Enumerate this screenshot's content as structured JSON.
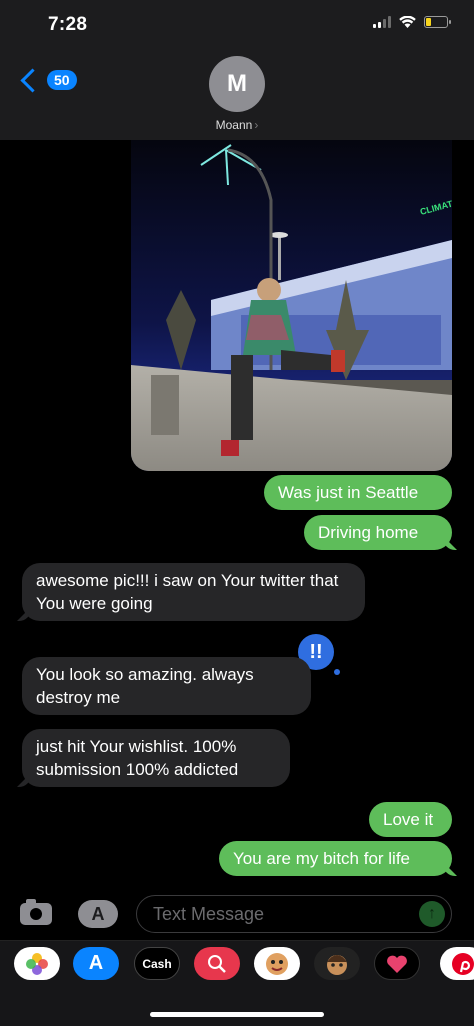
{
  "status_bar": {
    "time": "7:28"
  },
  "header": {
    "back_count": "50",
    "avatar_initial": "M",
    "contact_name": "Moann",
    "contact_chevron": "›"
  },
  "messages": [
    {
      "direction": "outgoing",
      "text": "Was just in Seattle"
    },
    {
      "direction": "outgoing",
      "text": "Driving home"
    },
    {
      "direction": "incoming",
      "text": "awesome pic!!! i saw on Your twitter that You were going"
    },
    {
      "direction": "incoming",
      "text": "You look so amazing.   always destroy me"
    },
    {
      "direction": "incoming",
      "text": "just hit Your wishlist. 100% submission 100% addicted"
    },
    {
      "direction": "outgoing",
      "text": "Love it"
    },
    {
      "direction": "outgoing",
      "text": "You are my bitch for life"
    }
  ],
  "photo": {
    "sign_text": "CLIMATE PLEDGE ARENA"
  },
  "tapback": {
    "symbol": "!!"
  },
  "input": {
    "placeholder": "Text Message",
    "value": ""
  },
  "app_drawer": {
    "cash_label": "Cash",
    "app_store_glyph": "A"
  },
  "colors": {
    "outgoing_bubble": "#5ebd5a",
    "incoming_bubble": "#262628",
    "accent": "#0a84ff",
    "battery": "#f7d51d"
  }
}
